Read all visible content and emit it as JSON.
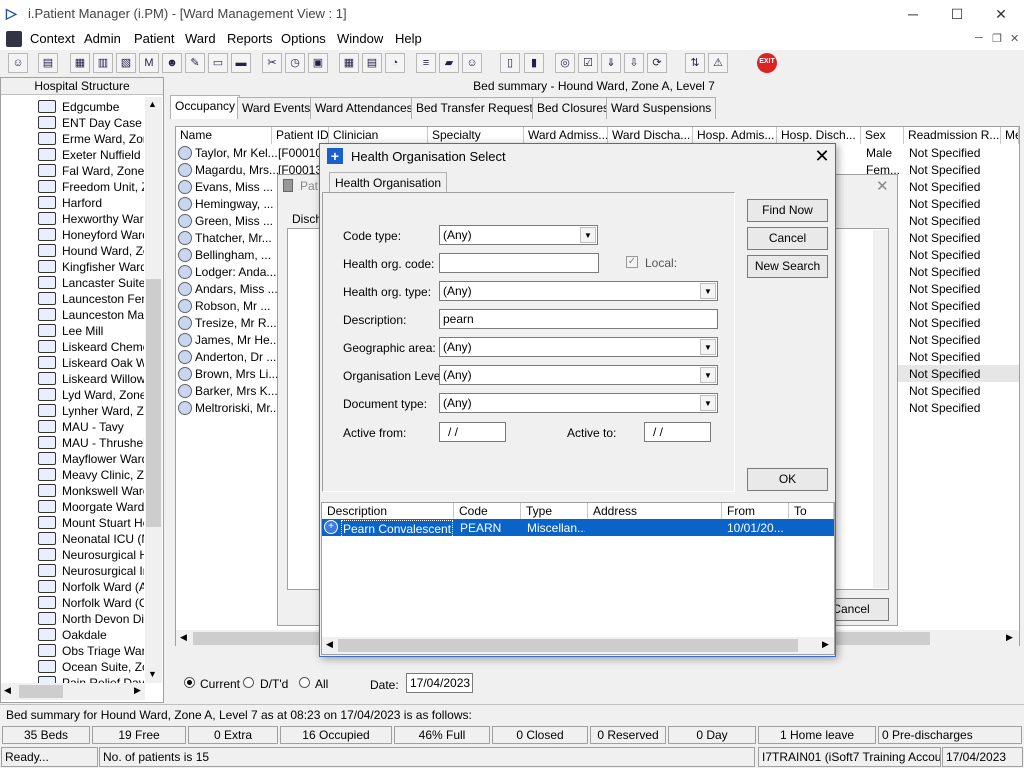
{
  "app_title": "i.Patient Manager (i.PM) - [Ward Management View : 1]",
  "menu": [
    "Context",
    "Admin",
    "Patient",
    "Ward",
    "Reports",
    "Options",
    "Window",
    "Help"
  ],
  "exit_label": "EXIT",
  "left": {
    "header": "Hospital Structure",
    "items": [
      "Edgcumbe",
      "ENT Day Case U",
      "Erme Ward, Zone",
      "Exeter Nuffield H",
      "Fal Ward, Zone E",
      "Freedom Unit, Zo",
      "Harford",
      "Hexworthy Ward,",
      "Honeyford Ward,",
      "Hound Ward, Zon",
      "Kingfisher Ward",
      "Lancaster Suite, Z",
      "Launceston Fema",
      "Launceston Male",
      "Lee Mill",
      "Liskeard Chemo D",
      "Liskeard Oak Wa",
      "Liskeard Willow V",
      "Lyd Ward, Zone I",
      "Lynher Ward, Zon",
      "MAU - Tavy",
      "MAU - Thrushel",
      "Mayflower Ward,",
      "Meavy Clinic, Zon",
      "Monkswell Ward,",
      "Moorgate Ward, Z",
      "Mount Stuart Hos",
      "Neonatal ICU (NN",
      "Neurosurgical Hig",
      "Neurosurgical Inte",
      "Norfolk Ward (Ad",
      "Norfolk Ward (Co",
      "North Devon Dist",
      "Oakdale",
      "Obs Triage Ward",
      "Ocean Suite, Zor",
      "Pain Relief Day C"
    ]
  },
  "main": {
    "title": "Bed summary - Hound Ward, Zone A, Level 7",
    "tabs": [
      "Occupancy",
      "Ward Events",
      "Ward Attendances",
      "Bed Transfer Requests",
      "Bed Closures",
      "Ward Suspensions"
    ],
    "columns": [
      "Name",
      "Patient ID",
      "Clinician",
      "Specialty",
      "Ward Admiss...",
      "Ward Discha...",
      "Hosp. Admis...",
      "Hosp. Disch...",
      "Sex",
      "Readmission R...",
      "Me"
    ],
    "rows": [
      {
        "name": "Taylor, Mr Kel...",
        "pid": "[F00010",
        "sex": "Male",
        "readm": "Not Specified"
      },
      {
        "name": "Magardu, Mrs...",
        "pid": "[F00013",
        "sex": "Fem...",
        "readm": "Not Specified"
      },
      {
        "name": "Evans, Miss ...",
        "pid": "",
        "sex": "",
        "readm": "Not Specified"
      },
      {
        "name": "Hemingway, ...",
        "pid": "",
        "sex": "",
        "readm": "Not Specified"
      },
      {
        "name": "Green, Miss ...",
        "pid": "",
        "sex": "",
        "readm": "Not Specified"
      },
      {
        "name": "Thatcher, Mr...",
        "pid": "",
        "sex": "",
        "readm": "Not Specified"
      },
      {
        "name": "Bellingham, ...",
        "pid": "",
        "sex": "",
        "readm": "Not Specified"
      },
      {
        "name": "Lodger: Anda...",
        "pid": "",
        "sex": "",
        "readm": "Not Specified"
      },
      {
        "name": "Andars, Miss ...",
        "pid": "",
        "sex": "",
        "readm": "Not Specified"
      },
      {
        "name": "Robson, Mr ...",
        "pid": "",
        "sex": "",
        "readm": "Not Specified"
      },
      {
        "name": "Tresize, Mr R...",
        "pid": "",
        "sex": "",
        "readm": "Not Specified"
      },
      {
        "name": "James, Mr He...",
        "pid": "",
        "sex": "",
        "readm": "Not Specified"
      },
      {
        "name": "Anderton, Dr ...",
        "pid": "",
        "sex": "",
        "readm": "Not Specified"
      },
      {
        "name": "Brown, Mrs Li...",
        "pid": "",
        "sex": "",
        "readm": "Not Specified"
      },
      {
        "name": "Barker, Mrs K...",
        "pid": "",
        "sex": "",
        "readm": "Not Specified"
      },
      {
        "name": "Meltroriski, Mr...",
        "pid": "",
        "sex": "",
        "readm": "Not Specified"
      }
    ],
    "bg_dialog_title": "Pat",
    "bg_dialog_label": "Disch",
    "bg_cancel": "Cancel",
    "filter": {
      "current": "Current",
      "dtd": "D/T'd",
      "all": "All",
      "date_label": "Date:",
      "date_value": "17/04/2023"
    }
  },
  "dialog": {
    "title": "Health Organisation Select",
    "tab": "Health Organisation",
    "fields": {
      "code_type_label": "Code type:",
      "code_type": "(Any)",
      "org_code_label": "Health org. code:",
      "org_code": "",
      "local_label": "Local:",
      "org_type_label": "Health org. type:",
      "org_type": "(Any)",
      "description_label": "Description:",
      "description": "pearn",
      "geo_label": "Geographic area:",
      "geo": "(Any)",
      "org_level_label": "Organisation Level:",
      "org_level": "(Any)",
      "doc_type_label": "Document type:",
      "doc_type": "(Any)",
      "active_from_label": "Active from:",
      "active_from": "/ /",
      "active_to_label": "Active to:",
      "active_to": "/ /"
    },
    "buttons": {
      "find": "Find Now",
      "cancel": "Cancel",
      "new_search": "New Search",
      "ok": "OK"
    },
    "results_columns": [
      "Description",
      "Code",
      "Type",
      "Address",
      "From",
      "To"
    ],
    "result": {
      "description": "Pearn Convalescent ...",
      "code": "PEARN",
      "type": "Miscellan...",
      "address": "",
      "from": "10/01/20...",
      "to": ""
    }
  },
  "summary": {
    "line": "Bed summary for Hound Ward, Zone A, Level 7 as at 08:23 on 17/04/2023 is as follows:",
    "stats": [
      "35 Beds",
      "19 Free",
      "0 Extra",
      "16 Occupied",
      "46% Full",
      "0 Closed",
      "0 Reserved",
      "0 Day",
      "1 Home leave",
      "0 Pre-discharges"
    ]
  },
  "status": {
    "ready": "Ready...",
    "patients": "No. of patients is 15",
    "user": "I7TRAIN01 (iSoft7 Training Account)",
    "date": "17/04/2023"
  }
}
